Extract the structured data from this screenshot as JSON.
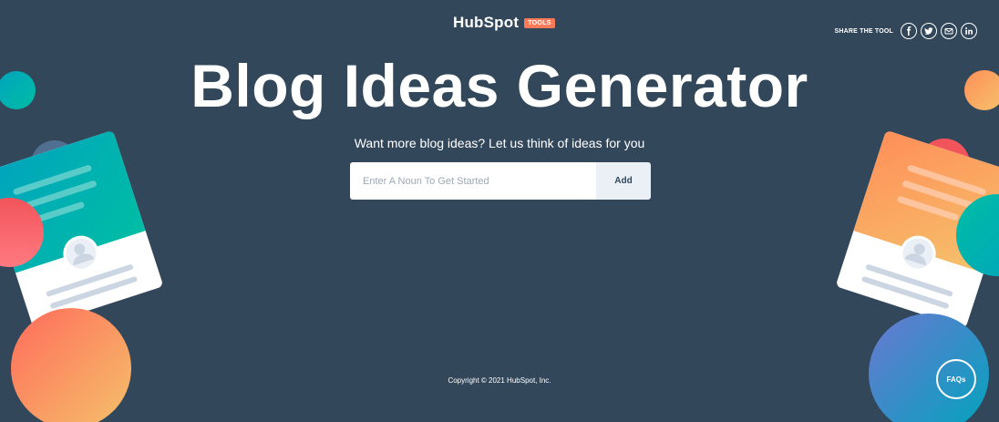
{
  "header": {
    "logo_text": "HubSpot",
    "logo_badge": "TOOLS",
    "share_label": "SHARE THE TOOL",
    "share_icons": [
      "facebook-icon",
      "twitter-icon",
      "email-icon",
      "linkedin-icon"
    ]
  },
  "hero": {
    "title": "Blog Ideas Generator",
    "subtitle": "Want more blog ideas? Let us think of ideas for you"
  },
  "form": {
    "placeholder": "Enter A Noun To Get Started",
    "add_label": "Add"
  },
  "footer": {
    "copyright": "Copyright © 2021 HubSpot, Inc.",
    "faq_label": "FAQs"
  },
  "colors": {
    "background": "#33475b",
    "accent": "#ff7a59",
    "teal": "#00bda5",
    "button_bg": "#eaf0f6"
  }
}
